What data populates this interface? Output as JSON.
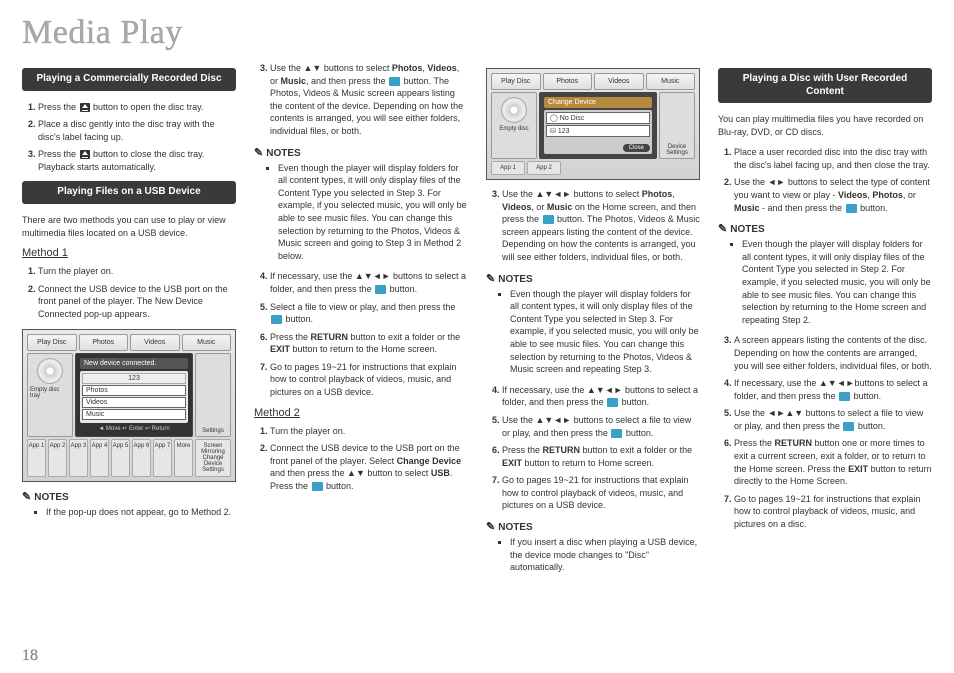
{
  "pageTitle": "Media Play",
  "pageNumber": "18",
  "col1": {
    "bar1": "Playing a Commercially Recorded Disc",
    "s1_1": "Press the ",
    "s1_1b": " button to open the disc tray.",
    "s1_2": "Place a disc gently into the disc tray with the disc's label facing up.",
    "s1_3a": "Press the ",
    "s1_3b": " button to close the disc tray. Playback starts automatically.",
    "bar2": "Playing Files on a USB Device",
    "intro2": "There are two methods you can use to play or view multimedia files located on a USB device.",
    "m1": "Method 1",
    "m1_1": "Turn the player on.",
    "m1_2": "Connect the USB device to the USB port on the front panel of the player. The New Device Connected pop-up appears.",
    "fig": {
      "tabs": [
        "Play Disc",
        "Photos",
        "Videos",
        "Music"
      ],
      "discLabel": "Empty disc tray",
      "panelHead": "New device connected.",
      "rows": [
        "123",
        "Photos",
        "Videos",
        "Music"
      ],
      "actions": "◄ Move   ↵ Enter   ↩ Return",
      "settings": "Settings",
      "apps": [
        "App 1",
        "App 2",
        "App 3",
        "App 4",
        "App 5",
        "App 6",
        "App 7",
        "More"
      ],
      "stripRight": "Screen Mirroring  Change Device  Settings"
    },
    "notesHead": "NOTES",
    "note1": "If the pop-up does not appear, go to Method 2."
  },
  "col2": {
    "s3a": "Use the ▲▼ buttons to select ",
    "s3b": "Photos",
    "s3c": ", ",
    "s3d": "Videos",
    "s3e": ", or ",
    "s3f": "Music",
    "s3g": ", and then press the ",
    "s3h": " button. The Photos, Videos & Music screen appears listing the content of the device. Depending on how the contents is arranged, you will see either folders, individual files, or both.",
    "notesHead": "NOTES",
    "note1": "Even though the player will display folders for all content types, it will only display files of the Content Type you selected in Step 3. For example, if you selected music, you will only be able to see music files. You can change this selection by returning to the Photos, Videos & Music screen and going to Step 3 in Method 2 below.",
    "s4a": "If necessary, use the ▲▼◄► buttons to select a folder, and then press the ",
    "s4b": " button.",
    "s5a": "Select a file to view or play, and then press the ",
    "s5b": " button.",
    "s6": "Press the RETURN button to exit a folder or the EXIT button to return to the Home screen.",
    "s7": "Go to pages 19~21 for instructions that explain how to control playback of videos, music, and pictures on a USB device.",
    "m2": "Method 2",
    "m2_1": "Turn the player on.",
    "m2_2a": "Connect the USB device to the USB port on the front panel of the player. Select ",
    "m2_2b": "Change Device",
    "m2_2c": " and then press the ▲▼ button to select ",
    "m2_2d": "USB",
    "m2_2e": ". Press the ",
    "m2_2f": " button."
  },
  "col3": {
    "fig": {
      "tabs": [
        "Play Disc",
        "Photos",
        "Videos",
        "Music"
      ],
      "panelHead": "Change Device",
      "rowLabel": "No Disc",
      "rowLabel2": "123",
      "discLabel": "Empty disc",
      "close": "Close",
      "settings": "Device Settings",
      "apps": [
        "App 1",
        "App 2"
      ]
    },
    "s3a": "Use the ▲▼◄► buttons to select ",
    "s3b": "Photos",
    "s3c": ", ",
    "s3d": "Videos",
    "s3e": ", or ",
    "s3f": "Music",
    "s3g": " on the Home screen, and then press the ",
    "s3h": " button. The Photos, Videos & Music screen appears listing the content of the device. Depending on how the contents is arranged, you will see either folders, individual files, or both.",
    "notesHead1": "NOTES",
    "note1": "Even though the player will display folders for all content types, it will only display files of the Content Type you selected in Step 3. For example, if you selected music, you will only be able to see music files. You can change this selection by returning to the Photos, Videos & Music screen and repeating Step 3.",
    "s4a": "If necessary, use the ▲▼◄► buttons to select a folder, and then press the ",
    "s4b": " button.",
    "s5a": "Use the ▲▼◄► buttons to select a file to view or play, and then press the ",
    "s5b": " button.",
    "s6": "Press the RETURN button to exit a folder or the EXIT button to return to Home screen.",
    "s7": "Go to pages 19~21 for instructions that explain how to control playback of videos, music, and pictures on a USB device.",
    "notesHead2": "NOTES",
    "note2": "If you insert a disc when playing a USB device, the device mode changes to \"Disc\" automatically."
  },
  "col4": {
    "bar": "Playing a Disc with User Recorded Content",
    "intro": "You can play multimedia files you have recorded on Blu-ray, DVD, or CD discs.",
    "s1": "Place a user recorded disc into the disc tray with the disc's label facing up, and then close the tray.",
    "s2a": "Use the ◄► buttons to select the type of content you want to view or play - ",
    "s2b": "Videos",
    "s2c": ", ",
    "s2d": "Photos",
    "s2e": ", or ",
    "s2f": "Music",
    "s2g": " - and then press the ",
    "s2h": " button.",
    "notesHead": "NOTES",
    "note1": "Even though the player will display folders for all content types, it will only display files of the Content Type you selected in Step 2. For example, if you selected music, you will only be able to see music files. You can change this selection by returning to the Home screen and repeating Step 2.",
    "s3": "A screen appears listing the contents of the disc. Depending on how the contents are arranged, you will see either folders, individual files, or both.",
    "s4a": "If necessary, use the ▲▼◄►buttons to select a folder, and then press the ",
    "s4b": " button.",
    "s5a": "Use the ◄►▲▼ buttons to select a file to view or play, and then press the ",
    "s5b": " button.",
    "s6": "Press the RETURN button one or more times to exit a current screen, exit a folder, or to return to the Home screen. Press the EXIT button to return directly to the Home Screen.",
    "s7": "Go to pages 19~21 for instructions that explain how to control playback of videos, music, and pictures on a disc."
  }
}
